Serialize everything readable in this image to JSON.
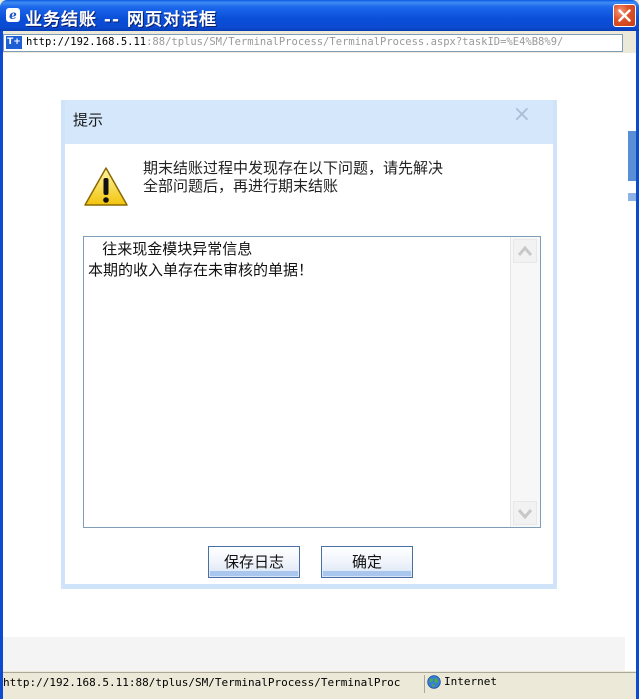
{
  "window": {
    "title": "业务结账 -- 网页对话框",
    "close_label": "×"
  },
  "address": {
    "icon_text": "T+",
    "host": "http://192.168.5.11",
    "path": ":88/tplus/SM/TerminalProcess/TerminalProcess.aspx?taskID=%E4%B8%9/"
  },
  "dialog": {
    "title": "提示",
    "close_symbol": "×",
    "message_line1": "期末结账过程中发现存在以下问题，请先解决",
    "message_line2": "全部问题后，再进行期末结账",
    "detail_text": "   往来现金模块异常信息\n本期的收入单存在未审核的单据！",
    "buttons": {
      "save_log": "保存日志",
      "ok": "确定"
    }
  },
  "statusbar": {
    "url": "http://192.168.5.11:88/tplus/SM/TerminalProcess/TerminalProc",
    "zone": "Internet"
  },
  "colors": {
    "titlebar": "#0a4fd8",
    "modal_header": "#d5e8fb",
    "modal_border": "#cfe4f9",
    "close_button": "#e0532a"
  }
}
